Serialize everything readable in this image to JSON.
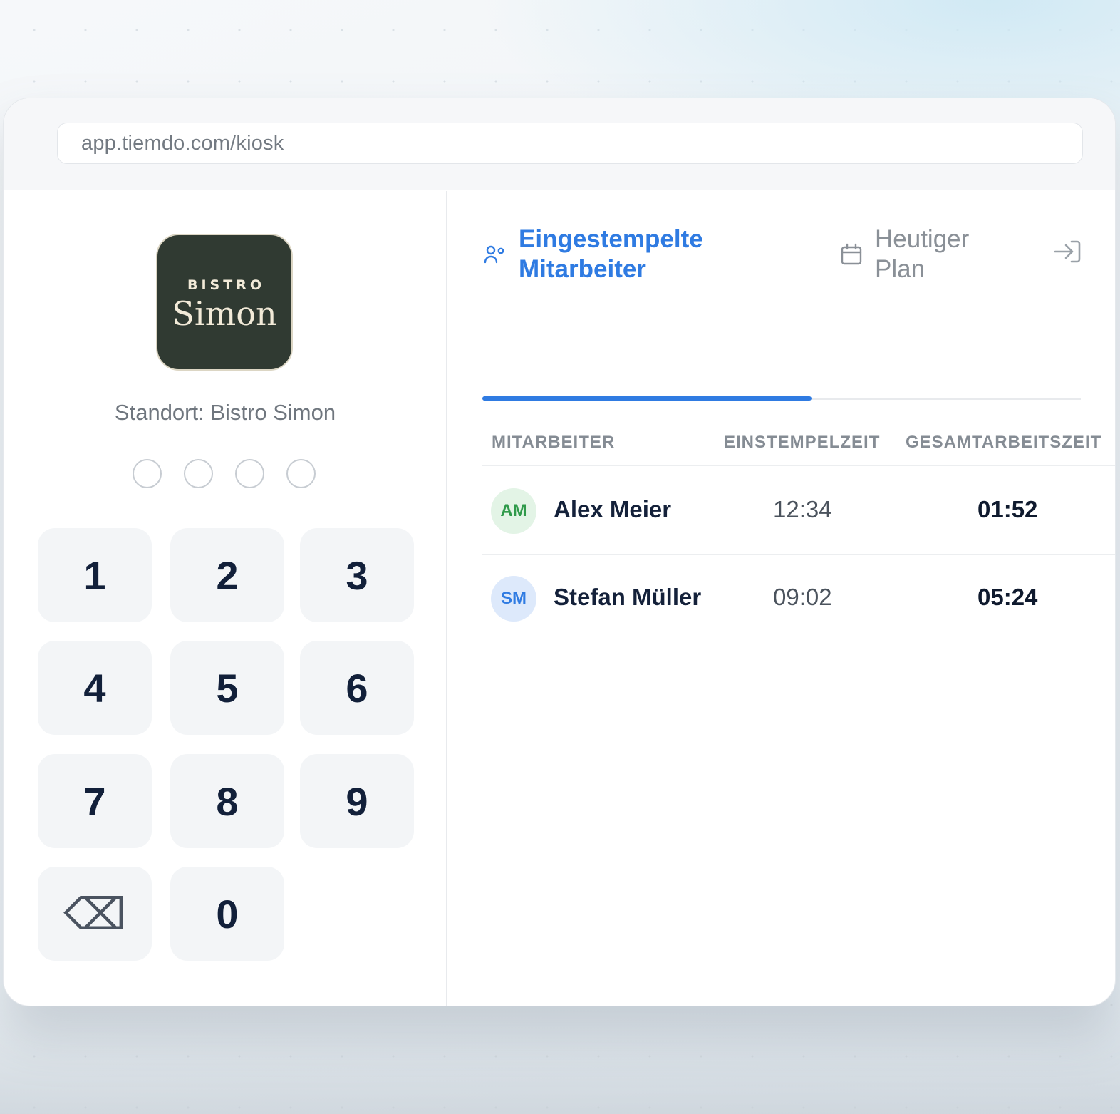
{
  "browser": {
    "url": "app.tiemdo.com/kiosk"
  },
  "logo": {
    "line1": "BISTRO",
    "line2": "Simon"
  },
  "location_label": "Standort: Bistro Simon",
  "pin": {
    "length": 4,
    "entered": 0
  },
  "keypad": {
    "keys": [
      "1",
      "2",
      "3",
      "4",
      "5",
      "6",
      "7",
      "8",
      "9",
      "⌫",
      "0"
    ]
  },
  "tabs": [
    {
      "label": "Eingestempelte Mitarbeiter",
      "icon": "users-icon",
      "active": true
    },
    {
      "label": "Heutiger Plan",
      "icon": "calendar-icon",
      "active": false
    }
  ],
  "exit_icon": "sign-in-icon",
  "table": {
    "columns": [
      "MITARBEITER",
      "EINSTEMPELZEIT",
      "GESAMTARBEITSZEIT"
    ],
    "rows": [
      {
        "initials": "AM",
        "name": "Alex Meier",
        "clock_in": "12:34",
        "total": "01:52",
        "avatar_bg": "#e3f4e6",
        "avatar_fg": "#2f9a4a"
      },
      {
        "initials": "SM",
        "name": "Stefan Müller",
        "clock_in": "09:02",
        "total": "05:24",
        "avatar_bg": "#dde9fb",
        "avatar_fg": "#2f7be2"
      }
    ]
  },
  "colors": {
    "accent": "#2f7be2",
    "logo_bg": "#303a32"
  }
}
